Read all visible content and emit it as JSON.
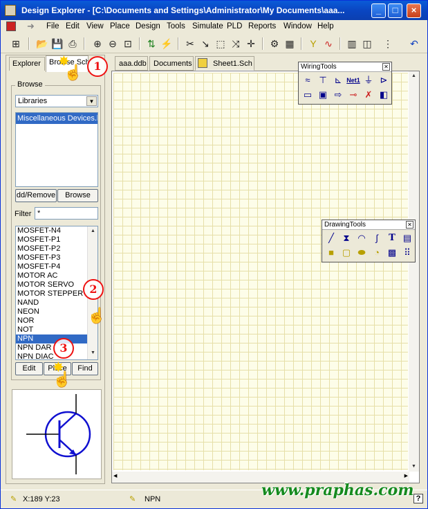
{
  "window": {
    "title": "Design Explorer - [C:\\Documents and Settings\\Administrator\\My Documents\\aaa...",
    "minimize": "_",
    "maximize": "□",
    "close": "×"
  },
  "menu": [
    "File",
    "Edit",
    "View",
    "Place",
    "Design",
    "Tools",
    "Simulate",
    "PLD",
    "Reports",
    "Window",
    "Help"
  ],
  "left_panel": {
    "tabs": [
      "Explorer",
      "Browse Sch"
    ],
    "group_label": "Browse",
    "library_select": "Libraries",
    "library_selected": "Miscellaneous Devices.lib",
    "add_remove": "dd/Remove",
    "browse": "Browse",
    "filter_label": "Filter",
    "filter_value": "*",
    "components": [
      "MOSFET-N4",
      "MOSFET-P1",
      "MOSFET-P2",
      "MOSFET-P3",
      "MOSFET-P4",
      "MOTOR AC",
      "MOTOR SERVO",
      "MOTOR STEPPER",
      "NAND",
      "NEON",
      "NOR",
      "NOT",
      "NPN",
      "NPN DAR",
      "NPN DIAC"
    ],
    "selected_component": "NPN",
    "edit": "Edit",
    "place": "Place",
    "find": "Find"
  },
  "doc_tabs": [
    "aaa.ddb",
    "Documents",
    "Sheet1.Sch"
  ],
  "wiring_tools": {
    "title": "WiringTools",
    "net_label": "Net1"
  },
  "drawing_tools": {
    "title": "DrawingTools",
    "text_tool": "T"
  },
  "status": {
    "coords": "X:189 Y:23",
    "component": "NPN",
    "help": "?"
  },
  "watermark": "www.praphas.com",
  "callouts": [
    "1",
    "2",
    "3"
  ]
}
